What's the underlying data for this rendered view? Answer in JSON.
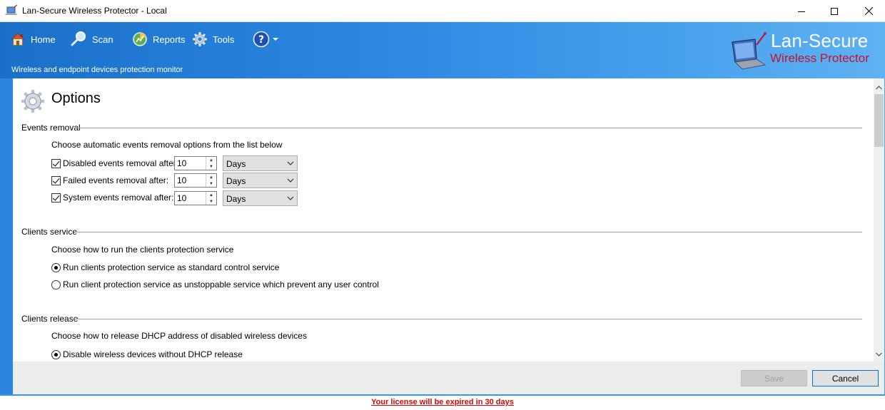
{
  "window": {
    "title": "Lan-Secure Wireless Protector - Local"
  },
  "nav": {
    "home": "Home",
    "scan": "Scan",
    "reports": "Reports",
    "tools": "Tools"
  },
  "header": {
    "subtitle": "Wireless and endpoint devices protection monitor",
    "brand_line1": "Lan-Secure",
    "brand_line2": "Wireless Protector"
  },
  "page": {
    "title": "Options"
  },
  "events_removal": {
    "heading": "Events removal",
    "description": "Choose automatic events removal options from the list below",
    "rows": [
      {
        "label": "Disabled events removal after:",
        "checked": true,
        "value": "10",
        "unit": "Days"
      },
      {
        "label": "Failed events removal after:",
        "checked": true,
        "value": "10",
        "unit": "Days"
      },
      {
        "label": "System events removal after:",
        "checked": true,
        "value": "10",
        "unit": "Days"
      }
    ]
  },
  "clients_service": {
    "heading": "Clients service",
    "description": "Choose how to run the clients protection service",
    "option1": "Run clients protection service as standard control service",
    "option2": "Run client protection service as unstoppable service which prevent any user control"
  },
  "clients_release": {
    "heading": "Clients release",
    "description": "Choose how to release DHCP address of disabled wireless devices",
    "option1": "Disable wireless devices without DHCP release"
  },
  "footer": {
    "save": "Save",
    "cancel": "Cancel"
  },
  "status": {
    "license": "Your license will be expired in 30 days"
  },
  "colors": {
    "accent": "#2a86e0",
    "brand_red": "#c8102e",
    "license_red": "#e00000"
  }
}
